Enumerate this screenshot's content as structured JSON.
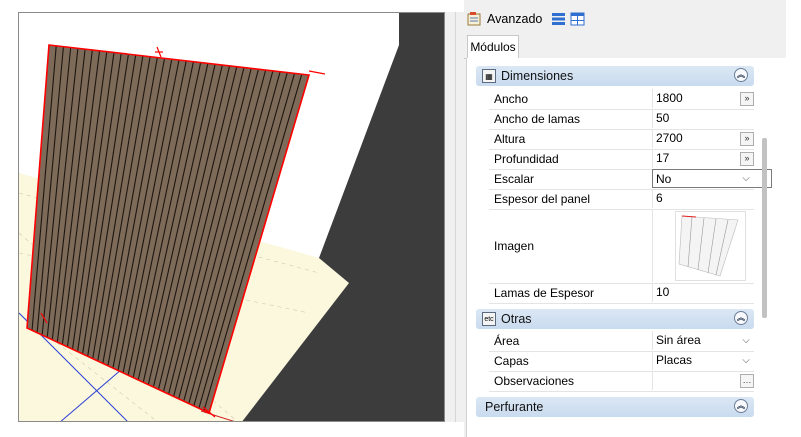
{
  "toolbar": {
    "avanzado_label": "Avanzado",
    "icons": [
      "properties-icon",
      "list-view-icon",
      "grid-view-icon"
    ]
  },
  "tabs": [
    {
      "label": "Módulos"
    }
  ],
  "sections": {
    "dimensiones": {
      "title": "Dimensiones",
      "icon": "dimensions-icon",
      "rows": [
        {
          "label": "Ancho",
          "value": "1800",
          "control": "more"
        },
        {
          "label": "Ancho de lamas",
          "value": "50"
        },
        {
          "label": "Altura",
          "value": "2700",
          "control": "more"
        },
        {
          "label": "Profundidad",
          "value": "17",
          "control": "more"
        },
        {
          "label": "Escalar",
          "value": "No",
          "control": "combo"
        },
        {
          "label": "Espesor del panel",
          "value": "6"
        },
        {
          "label": "Imagen",
          "value": ""
        },
        {
          "label": "Lamas de Espesor",
          "value": "10"
        }
      ]
    },
    "otras": {
      "title": "Otras",
      "icon": "etc",
      "rows": [
        {
          "label": "Área",
          "value": "Sin área",
          "control": "combo"
        },
        {
          "label": "Capas",
          "value": "Placas",
          "control": "combo"
        },
        {
          "label": "Observaciones",
          "value": "",
          "control": "more"
        }
      ]
    },
    "perfurante": {
      "title": "Perfurante"
    }
  },
  "glyphs": {
    "more": "»",
    "combo": "⌵",
    "collapse": "︽"
  },
  "colors": {
    "section_header": "#c9dbef",
    "panel_edge": "#ff0000",
    "slat": "#7d6a58",
    "floor": "#fbf8de",
    "viewport_bg": "#3c3c3c"
  }
}
